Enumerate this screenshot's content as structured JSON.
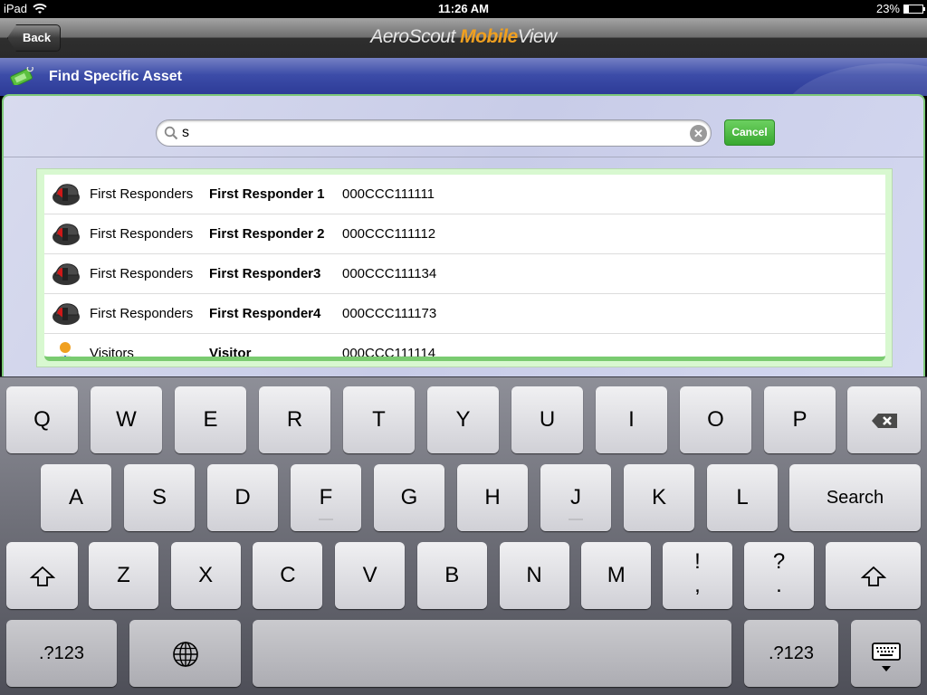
{
  "status_bar": {
    "device": "iPad",
    "time": "11:26 AM",
    "battery_label": "23%",
    "battery_level": 0.23
  },
  "nav_bar": {
    "back_label": "Back",
    "brand_part1": "AeroScout ",
    "brand_part2": "Mobile",
    "brand_part3": "View"
  },
  "header": {
    "title": "Find Specific Asset",
    "icon": "tag-icon"
  },
  "search": {
    "value": "s",
    "placeholder": "",
    "clear_icon": "clear-icon",
    "cancel_label": "Cancel"
  },
  "results": [
    {
      "icon": "firefighter-helmet-icon",
      "group": "First Responders",
      "name": "First Responder 1",
      "mac": "000CCC111111"
    },
    {
      "icon": "firefighter-helmet-icon",
      "group": "First Responders",
      "name": "First Responder 2",
      "mac": "000CCC111112"
    },
    {
      "icon": "firefighter-helmet-icon",
      "group": "First Responders",
      "name": "First Responder3",
      "mac": "000CCC111134"
    },
    {
      "icon": "firefighter-helmet-icon",
      "group": "First Responders",
      "name": "First Responder4",
      "mac": "000CCC111173"
    },
    {
      "icon": "visitor-person-icon",
      "group": "Visitors",
      "name": "Visitor",
      "mac": "000CCC111114"
    }
  ],
  "keyboard": {
    "row1": [
      "Q",
      "W",
      "E",
      "R",
      "T",
      "Y",
      "U",
      "I",
      "O",
      "P"
    ],
    "row2": [
      "A",
      "S",
      "D",
      "F",
      "G",
      "H",
      "J",
      "K",
      "L"
    ],
    "row3": [
      "Z",
      "X",
      "C",
      "V",
      "B",
      "N",
      "M"
    ],
    "search_label": "Search",
    "punct1_top": "!",
    "punct1_bottom": ",",
    "punct2_top": "?",
    "punct2_bottom": ".",
    "numbers_label": ".?123",
    "numbers_label_right": ".?123"
  }
}
